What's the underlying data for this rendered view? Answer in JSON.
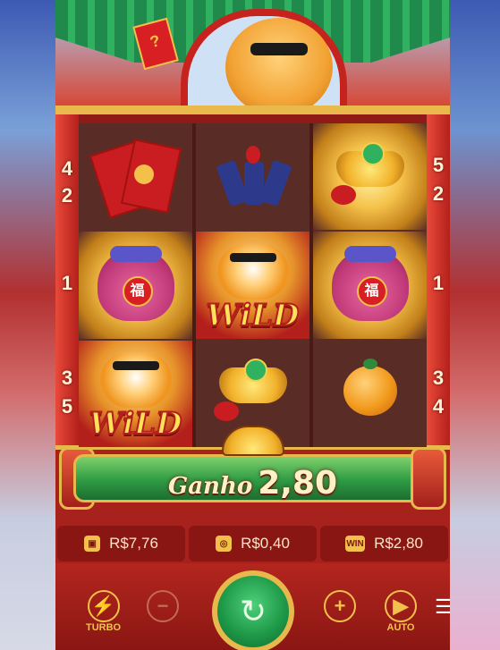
{
  "reels": {
    "col1": [
      "envelopes",
      "bag",
      "wild"
    ],
    "col2": [
      "firecracker",
      "wild",
      "ingot"
    ],
    "col3": [
      "ingot",
      "bag",
      "orange"
    ],
    "wild_label": "WiLD",
    "fu_char": "福"
  },
  "multipliers": {
    "left": [
      "4",
      "2",
      "1",
      "3",
      "5"
    ],
    "right": [
      "5",
      "2",
      "1",
      "3",
      "4"
    ]
  },
  "top_envelope_glyph": "?",
  "win_banner": {
    "label": "Ganho",
    "amount": "2,80"
  },
  "stats": {
    "balance": "R$7,76",
    "bet": "R$0,40",
    "win": "R$2,80",
    "win_icon_text": "WIN"
  },
  "controls": {
    "turbo_label": "TURBO",
    "auto_label": "AUTO",
    "minus_symbol": "−",
    "plus_symbol": "+",
    "menu_symbol": "☰"
  },
  "colors": {
    "gold": "#f3c14b",
    "red": "#b3201b",
    "green": "#2e9b44"
  },
  "icons": [
    "lightning-icon",
    "minus-icon",
    "spin-icon",
    "plus-icon",
    "play-icon",
    "menu-icon",
    "wallet-icon",
    "coins-icon",
    "win-icon"
  ]
}
